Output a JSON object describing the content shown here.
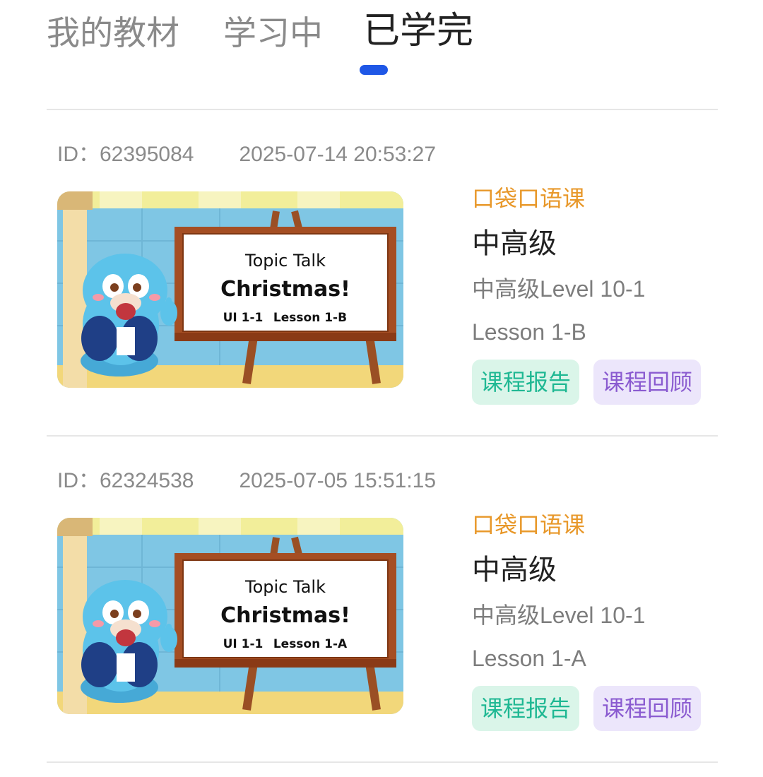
{
  "tabs": [
    {
      "label": "我的教材",
      "active": false
    },
    {
      "label": "学习中",
      "active": false
    },
    {
      "label": "已学完",
      "active": true
    }
  ],
  "colors": {
    "accent": "#1f57e6",
    "course_type": "#e8982a",
    "report_bg": "#daf5e9",
    "report_text": "#1fb893",
    "review_bg": "#ece6fb",
    "review_text": "#8a5bd0"
  },
  "courses": [
    {
      "id_label": "ID：62395084",
      "time": "2025-07-14 20:53:27",
      "thumbnail": {
        "line1": "Topic Talk",
        "line2": "Christmas!",
        "line3_unit": "UI 1-1",
        "line3_lesson": "Lesson 1-B"
      },
      "type": "口袋口语课",
      "level": "中高级",
      "level_detail": "中高级Level 10-1",
      "lesson": "Lesson 1-B",
      "report_label": "课程报告",
      "review_label": "课程回顾"
    },
    {
      "id_label": "ID：62324538",
      "time": "2025-07-05 15:51:15",
      "thumbnail": {
        "line1": "Topic Talk",
        "line2": "Christmas!",
        "line3_unit": "UI 1-1",
        "line3_lesson": "Lesson 1-A"
      },
      "type": "口袋口语课",
      "level": "中高级",
      "level_detail": "中高级Level 10-1",
      "lesson": "Lesson 1-A",
      "report_label": "课程报告",
      "review_label": "课程回顾"
    }
  ]
}
